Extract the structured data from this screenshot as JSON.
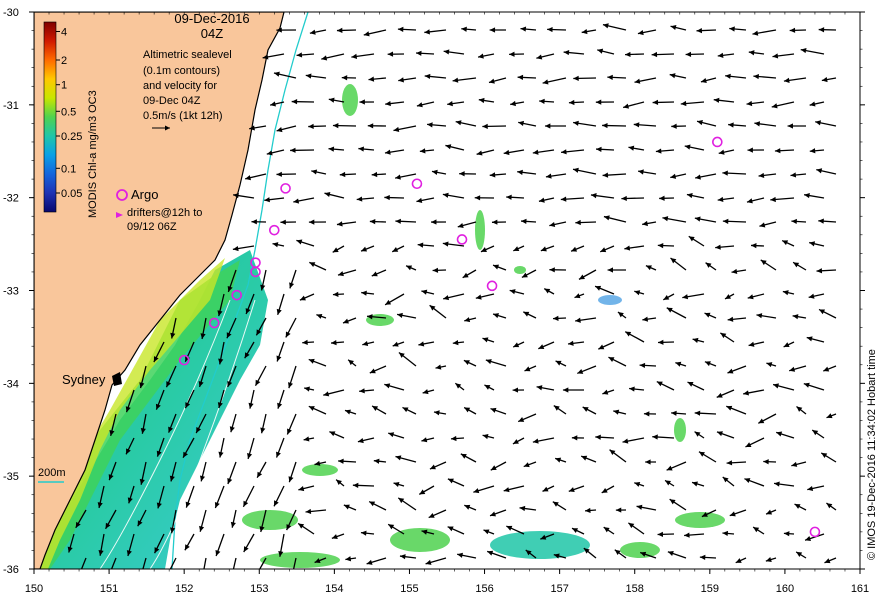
{
  "header": {
    "date": "09-Dec-2016",
    "time": "04Z"
  },
  "legend": {
    "velocity_lines": [
      "Altimetric sealevel",
      "(0.1m contours)",
      "and velocity for",
      "09-Dec 04Z",
      "0.5m/s (1kt 12h)"
    ],
    "argo_label": "Argo",
    "drifter_lines": [
      "drifters@12h to",
      "09/12 06Z"
    ],
    "isobath_label": "200m"
  },
  "colorbar": {
    "title": "MODIS Chl-a mg/m3 OC3",
    "ticks": [
      "4",
      "2",
      "1",
      "0.5",
      "0.25",
      "0.1",
      "0.05"
    ],
    "colors": [
      "#7f0000",
      "#d11a00",
      "#ff6a00",
      "#ffc800",
      "#c8e600",
      "#4fd24f",
      "#1fc6a8",
      "#0aa0e6",
      "#1464dc",
      "#1e32b4",
      "#08086e"
    ]
  },
  "map": {
    "place_label": "Sydney",
    "x_ticks": [
      "150",
      "151",
      "152",
      "153",
      "154",
      "155",
      "156",
      "157",
      "158",
      "159",
      "160",
      "161"
    ],
    "y_ticks": [
      "-30",
      "-31",
      "-32",
      "-33",
      "-34",
      "-35",
      "-36"
    ],
    "lon_range": [
      150,
      161
    ],
    "lat_range": [
      -36,
      -30
    ],
    "land_color": "#f9c69b",
    "argo_color": "#e020e0",
    "argo_floats": [
      {
        "lon": 159.1,
        "lat": -31.4
      },
      {
        "lon": 155.1,
        "lat": -31.85
      },
      {
        "lon": 153.35,
        "lat": -31.9
      },
      {
        "lon": 153.2,
        "lat": -32.35
      },
      {
        "lon": 155.7,
        "lat": -32.45
      },
      {
        "lon": 152.95,
        "lat": -32.7
      },
      {
        "lon": 152.95,
        "lat": -32.8
      },
      {
        "lon": 156.1,
        "lat": -32.95
      },
      {
        "lon": 152.7,
        "lat": -33.05
      },
      {
        "lon": 152.4,
        "lat": -33.35
      },
      {
        "lon": 152.0,
        "lat": -33.75
      },
      {
        "lon": 160.4,
        "lat": -35.6
      }
    ]
  },
  "credit": "© IMOS 19-Dec-2016 11:34:02 Hobart time"
}
